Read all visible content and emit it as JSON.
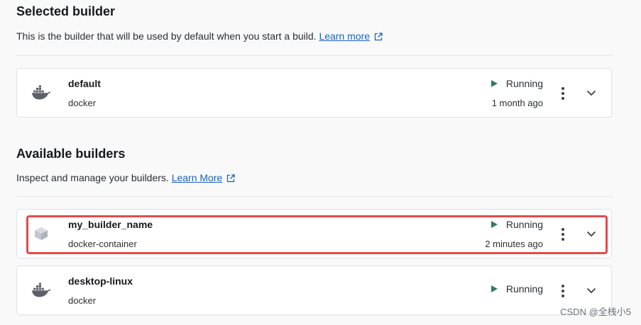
{
  "selected": {
    "title": "Selected builder",
    "description": "This is the builder that will be used by default when you start a build.",
    "link_label": "Learn more"
  },
  "available": {
    "title": "Available builders",
    "description": "Inspect and manage your builders.",
    "link_label": "Learn More"
  },
  "builders": {
    "default": {
      "name": "default",
      "driver": "docker",
      "status": "Running",
      "time": "1 month ago",
      "icon": "docker-whale-icon"
    },
    "mine": {
      "name": "my_builder_name",
      "driver": "docker-container",
      "status": "Running",
      "time": "2 minutes ago",
      "icon": "container-cube-icon"
    },
    "desktop": {
      "name": "desktop-linux",
      "driver": "docker",
      "status": "Running",
      "icon": "docker-whale-icon"
    }
  },
  "colors": {
    "accent_link": "#1a62c2",
    "running": "#2f7d5d",
    "highlight": "#e14b4b"
  },
  "watermark": "CSDN @全栈小5"
}
